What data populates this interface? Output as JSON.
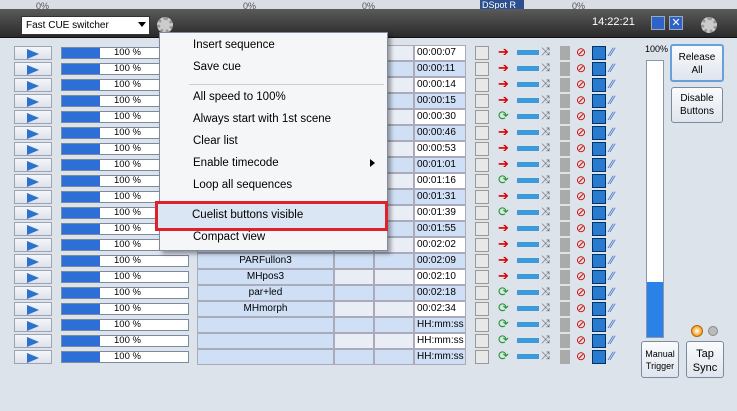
{
  "topstrip": {
    "pct1": "0%",
    "pct2": "0%",
    "pct3": "0%",
    "pct4": "0%",
    "dspot": "DSpot R"
  },
  "toolbar": {
    "selected_switcher": "Fast CUE switcher",
    "clock": "14:22:21"
  },
  "menu": {
    "items": [
      "Insert sequence",
      "Save cue",
      "All speed to 100%",
      "Always start with 1st scene",
      "Clear list",
      "Enable timecode",
      "Loop all sequences",
      "Cuelist buttons visible",
      "Compact view"
    ]
  },
  "rows": [
    {
      "pct": "100 %",
      "name": "",
      "time": "00:00:07",
      "arrow": "red"
    },
    {
      "pct": "100 %",
      "name": "",
      "time": "00:00:11",
      "arrow": "red"
    },
    {
      "pct": "100 %",
      "name": "",
      "time": "00:00:14",
      "arrow": "red"
    },
    {
      "pct": "100 %",
      "name": "",
      "time": "00:00:15",
      "arrow": "red"
    },
    {
      "pct": "100 %",
      "name": "",
      "time": "00:00:30",
      "arrow": "green"
    },
    {
      "pct": "100 %",
      "name": "",
      "time": "00:00:46",
      "arrow": "red"
    },
    {
      "pct": "100 %",
      "name": "",
      "time": "00:00:53",
      "arrow": "red"
    },
    {
      "pct": "100 %",
      "name": "",
      "time": "00:01:01",
      "arrow": "red"
    },
    {
      "pct": "100 %",
      "name": "",
      "time": "00:01:16",
      "arrow": "green"
    },
    {
      "pct": "100 %",
      "name": "",
      "time": "00:01:31",
      "arrow": "red"
    },
    {
      "pct": "100 %",
      "name": "",
      "time": "00:01:39",
      "arrow": "green"
    },
    {
      "pct": "100 %",
      "name": "",
      "time": "00:01:55",
      "arrow": "red"
    },
    {
      "pct": "100 %",
      "name": "",
      "time": "00:02:02",
      "arrow": "red"
    },
    {
      "pct": "100 %",
      "name": "PARFullon3",
      "time": "00:02:09",
      "arrow": "red"
    },
    {
      "pct": "100 %",
      "name": "MHpos3",
      "time": "00:02:10",
      "arrow": "red"
    },
    {
      "pct": "100 %",
      "name": "par+led",
      "time": "00:02:18",
      "arrow": "green"
    },
    {
      "pct": "100 %",
      "name": "MHmorph",
      "time": "00:02:34",
      "arrow": "green"
    },
    {
      "pct": "100 %",
      "name": "",
      "time": "HH:mm:ss",
      "arrow": "green"
    },
    {
      "pct": "100 %",
      "name": "",
      "time": "HH:mm:ss",
      "arrow": "green"
    },
    {
      "pct": "100 %",
      "name": "",
      "time": "HH:mm:ss",
      "arrow": "green"
    }
  ],
  "right_panel": {
    "meter_label": "100%",
    "meter_level": 0.2,
    "release": "Release All",
    "disable": "Disable Buttons",
    "manual": "Manual Trigger",
    "tap": "Tap Sync"
  }
}
